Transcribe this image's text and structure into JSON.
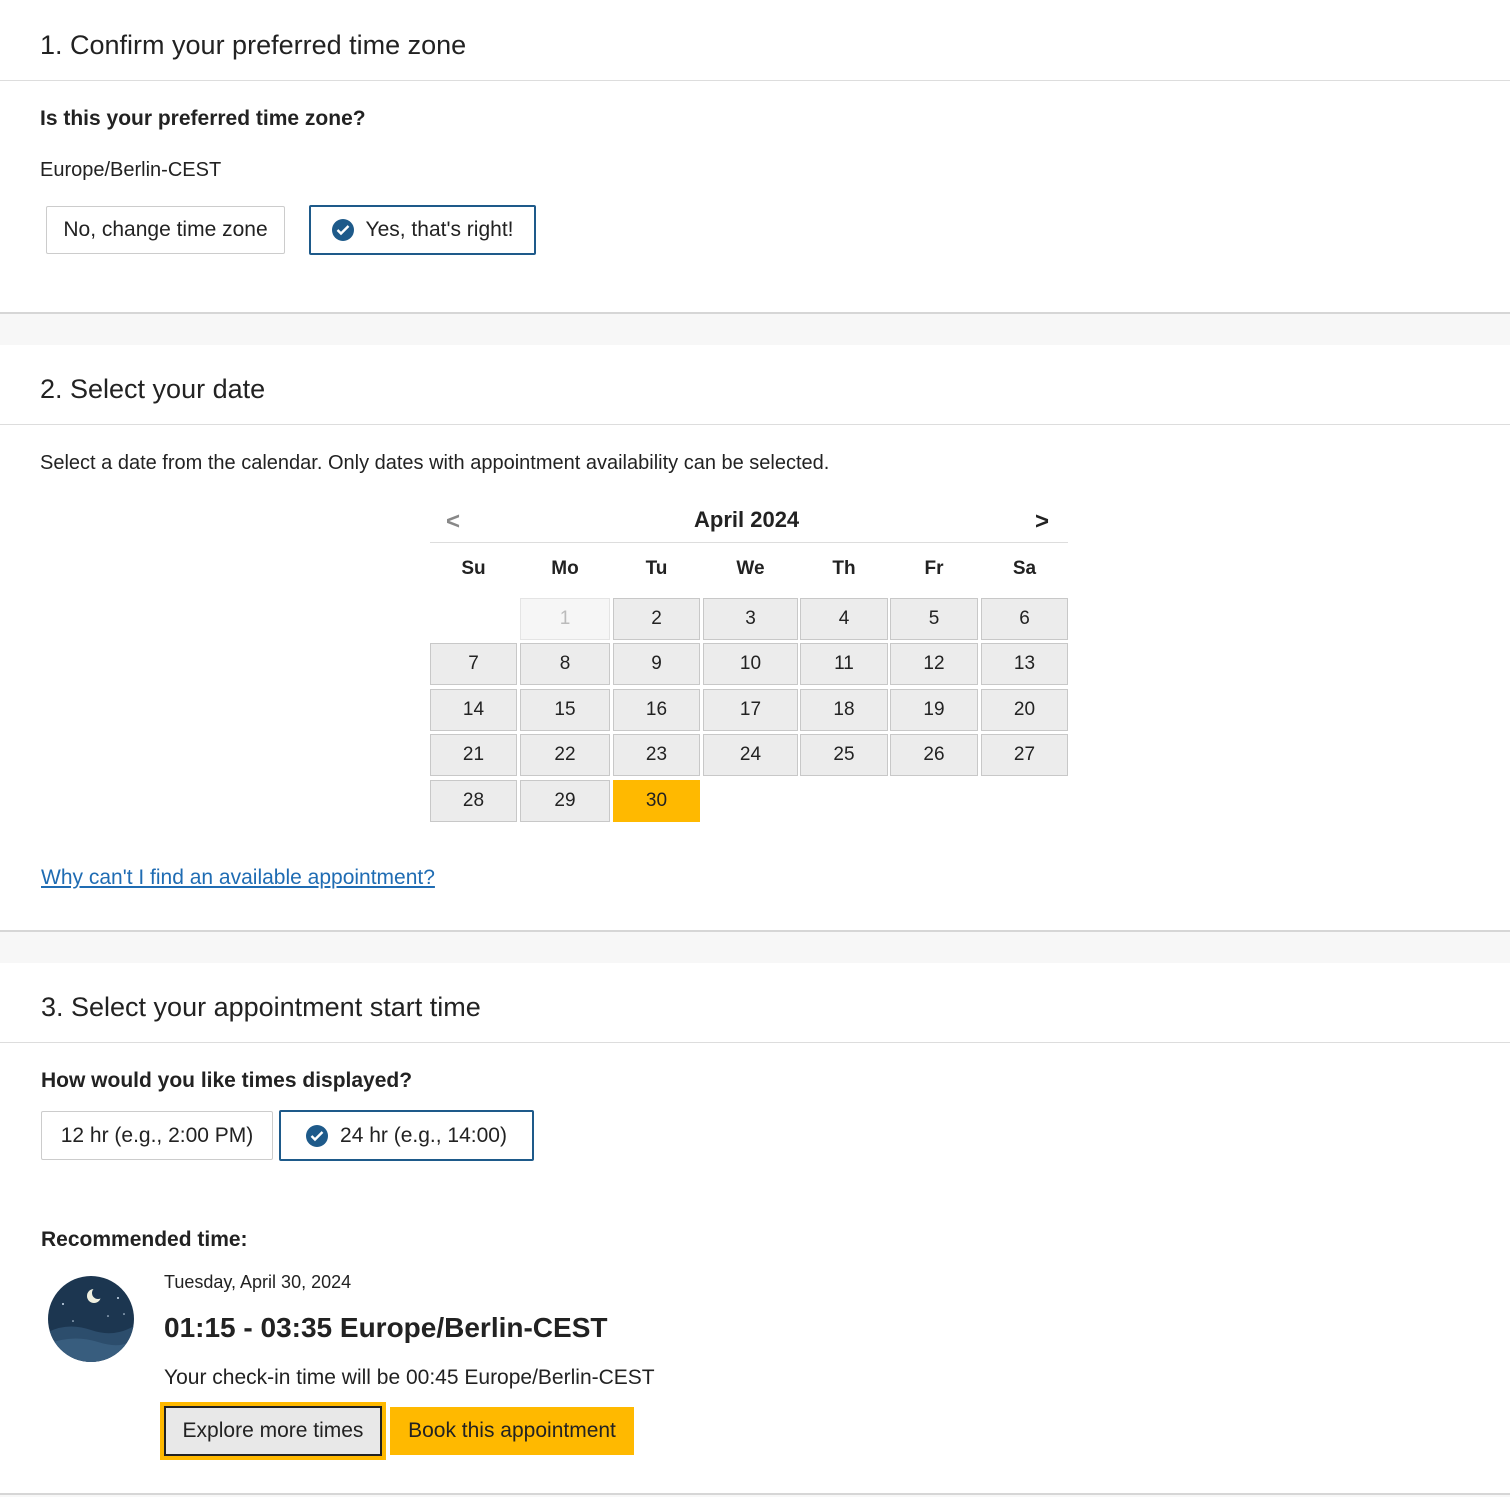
{
  "section1": {
    "title": "1. Confirm your preferred time zone",
    "question": "Is this your preferred time zone?",
    "timezone": "Europe/Berlin-CEST",
    "btn_change": "No, change time zone",
    "btn_confirm": "Yes, that's right!"
  },
  "section2": {
    "title": "2. Select your date",
    "instructions": "Select a date from the calendar. Only dates with appointment availability can be selected.",
    "calendar": {
      "month": "April 2024",
      "prev": "<",
      "next": ">",
      "weekdays": [
        "Su",
        "Mo",
        "Tu",
        "We",
        "Th",
        "Fr",
        "Sa"
      ],
      "days": [
        "1",
        "2",
        "3",
        "4",
        "5",
        "6",
        "7",
        "8",
        "9",
        "10",
        "11",
        "12",
        "13",
        "14",
        "15",
        "16",
        "17",
        "18",
        "19",
        "20",
        "21",
        "22",
        "23",
        "24",
        "25",
        "26",
        "27",
        "28",
        "29",
        "30"
      ],
      "disabled_day": "1",
      "selected_day": "30"
    },
    "help_link": "Why can't I find an available appointment?"
  },
  "section3": {
    "title": "3. Select your appointment start time",
    "question": "How would you like times displayed?",
    "btn_12": "12 hr (e.g., 2:00 PM)",
    "btn_24": "24 hr (e.g., 14:00)",
    "recommended_label": "Recommended time:",
    "date": "Tuesday, April 30, 2024",
    "time_range": "01:15 - 03:35 Europe/Berlin-CEST",
    "checkin": "Your check-in time will be 00:45 Europe/Berlin-CEST",
    "btn_explore": "Explore more times",
    "btn_book": "Book this appointment"
  },
  "colors": {
    "accent": "#ffb900",
    "selected_border": "#1e5a8a",
    "link": "#1f6cb3"
  },
  "icons": [
    "check-circle-icon",
    "night-moon-icon"
  ]
}
